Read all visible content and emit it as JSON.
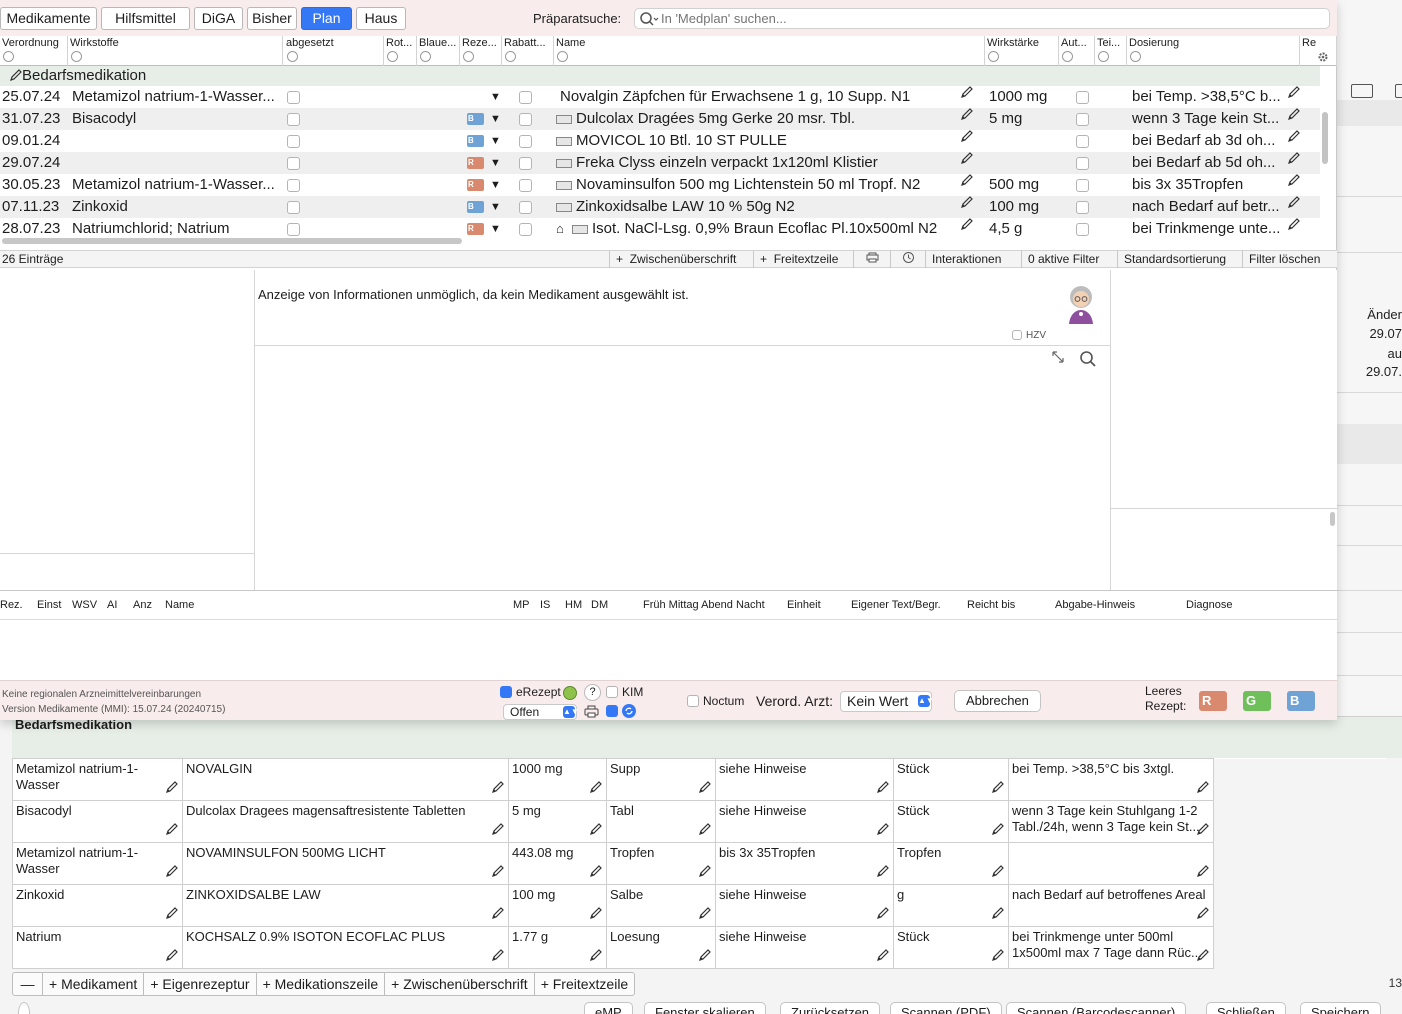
{
  "tabs": [
    {
      "label": "Medikamente",
      "active": false
    },
    {
      "label": "Hilfsmittel",
      "active": false
    },
    {
      "label": "DiGA",
      "active": false
    },
    {
      "label": "Bisher",
      "active": false
    },
    {
      "label": "Plan",
      "active": true
    },
    {
      "label": "Haus",
      "active": false
    }
  ],
  "search": {
    "label": "Präparatsuche:",
    "placeholder": "In 'Medplan' suchen..."
  },
  "columns": [
    "Verordnung",
    "Wirkstoffe",
    "abgesetzt",
    "Rot...",
    "Blaue...",
    "Reze...",
    "Rabatt...",
    "Name",
    "Wirkstärke",
    "Aut...",
    "Tei...",
    "Dosierung",
    "Re"
  ],
  "group_title": "Bedarfsmedikation",
  "meds": [
    {
      "date": "25.07.24",
      "active_ingredient": "Metamizol natrium-1-Wasser...",
      "rx": "",
      "name": "Novalgin Zäpfchen für Erwachsene 1 g, 10 Supp. N1",
      "strength": "1000 mg",
      "dosage": "bei Temp. >38,5°C b...",
      "pack_icon": false,
      "home_icon": false
    },
    {
      "date": "31.07.23",
      "active_ingredient": "Bisacodyl",
      "rx": "B",
      "name": "Dulcolax Dragées 5mg Gerke 20 msr. Tbl.",
      "strength": "5 mg",
      "dosage": "wenn 3 Tage kein St...",
      "pack_icon": true,
      "home_icon": false
    },
    {
      "date": "09.01.24",
      "active_ingredient": "",
      "rx": "B",
      "name": "MOVICOL 10 Btl. 10 ST PULLE",
      "strength": "",
      "dosage": "bei Bedarf ab 3d oh...",
      "pack_icon": true,
      "home_icon": false
    },
    {
      "date": "29.07.24",
      "active_ingredient": "",
      "rx": "R",
      "name": "Freka Clyss einzeln verpackt 1x120ml Klistier",
      "strength": "",
      "dosage": "bei Bedarf ab 5d oh...",
      "pack_icon": true,
      "home_icon": false
    },
    {
      "date": "30.05.23",
      "active_ingredient": "Metamizol natrium-1-Wasser...",
      "rx": "R",
      "name": "Novaminsulfon 500 mg Lichtenstein 50 ml Tropf. N2",
      "strength": "500 mg",
      "dosage": "bis 3x 35Tropfen",
      "pack_icon": true,
      "home_icon": false
    },
    {
      "date": "07.11.23",
      "active_ingredient": "Zinkoxid",
      "rx": "B",
      "name": "Zinkoxidsalbe LAW 10 % 50g N2",
      "strength": "100 mg",
      "dosage": "nach Bedarf auf betr...",
      "pack_icon": true,
      "home_icon": false
    },
    {
      "date": "28.07.23",
      "active_ingredient": "Natriumchlorid; Natrium",
      "rx": "R",
      "name": "Isot. NaCl-Lsg. 0,9% Braun Ecoflac Pl.10x500ml N2",
      "strength": "4,5 g",
      "dosage": "bei Trinkmenge unte...",
      "pack_icon": true,
      "home_icon": true
    }
  ],
  "status": {
    "count": "26 Einträge",
    "buttons": [
      "Zwischenüberschrift",
      "Freitextzeile",
      "Interaktionen",
      "0 aktive Filter",
      "Standardsortierung",
      "Filter löschen"
    ]
  },
  "info": {
    "message": "Anzeige von Informationen unmöglich, da kein Medikament ausgewählt ist.",
    "hzv_label": "HZV"
  },
  "rx_columns": [
    "Rez.",
    "Einst",
    "WSV",
    "AI",
    "Anz",
    "Name",
    "MP",
    "IS",
    "HM",
    "DM",
    "Früh Mittag Abend Nacht",
    "Einheit",
    "Eigener Text/Begr.",
    "Reicht bis",
    "Abgabe-Hinweis",
    "Diagnose"
  ],
  "footer": {
    "note1": "Keine regionalen Arzneimittelvereinbarungen",
    "note2": "Version Medikamente (MMI):  15.07.24 (20240715)",
    "erezept": "eRezept",
    "question": "?",
    "kim": "KIM",
    "status_value": "Offen",
    "noctum": "Noctum",
    "arzt_label": "Verord. Arzt:",
    "arzt_value": "Kein Wert",
    "cancel": "Abbrechen",
    "empty_rx_1": "Leeres",
    "empty_rx_2": "Rezept:",
    "rx_icons": [
      "R",
      "G",
      "B"
    ],
    "rx_colors": [
      "#d98a6e",
      "#6fbf5a",
      "#6fa3d6"
    ]
  },
  "background": {
    "right_labels": [
      "Änder",
      "29.07",
      "au",
      "29.07."
    ],
    "section_title": "Bedarfsmedikation",
    "plan_rows": [
      {
        "ingredient": "Metamizol natrium-1-Wasser",
        "trade": "NOVALGIN",
        "strength": "1000 mg",
        "form": "Supp",
        "dose": "siehe Hinweise",
        "unit": "Stück",
        "hint": "bei Temp. >38,5°C bis 3xtgl."
      },
      {
        "ingredient": "Bisacodyl",
        "trade": "Dulcolax Dragees magensaftresistente Tabletten",
        "strength": "5 mg",
        "form": "Tabl",
        "dose": "siehe Hinweise",
        "unit": "Stück",
        "hint": "wenn 3 Tage kein Stuhlgang 1-2 Tabl./24h, wenn 3 Tage kein St..."
      },
      {
        "ingredient": "Metamizol natrium-1-Wasser",
        "trade": "NOVAMINSULFON 500MG LICHT",
        "strength": "443.08 mg",
        "form": "Tropfen",
        "dose": "bis 3x 35Tropfen",
        "unit": "Tropfen",
        "hint": ""
      },
      {
        "ingredient": "Zinkoxid",
        "trade": "ZINKOXIDSALBE LAW",
        "strength": "100 mg",
        "form": "Salbe",
        "dose": "siehe Hinweise",
        "unit": "g",
        "hint": "nach Bedarf auf betroffenes Areal"
      },
      {
        "ingredient": "Natrium",
        "trade": "KOCHSALZ 0.9% ISOTON ECOFLAC PLUS",
        "strength": "1.77 g",
        "form": "Loesung",
        "dose": "siehe Hinweise",
        "unit": "Stück",
        "hint": "bei Trinkmenge unter 500ml 1x500ml max 7 Tage dann Rüc..."
      }
    ],
    "toolbar": [
      "—",
      "+  Medikament",
      "+  Eigenrezeptur",
      "+ Medikationszeile",
      "+  Zwischenüberschrift",
      "+ Freitextzeile"
    ],
    "toolbar_count": "13",
    "bottom_buttons": [
      "eMP",
      "Fenster skalieren",
      "Zurücksetzen",
      "Scannen (PDF)",
      "Scannen (Barcodescanner)",
      "Schließen",
      "Speichern"
    ]
  }
}
